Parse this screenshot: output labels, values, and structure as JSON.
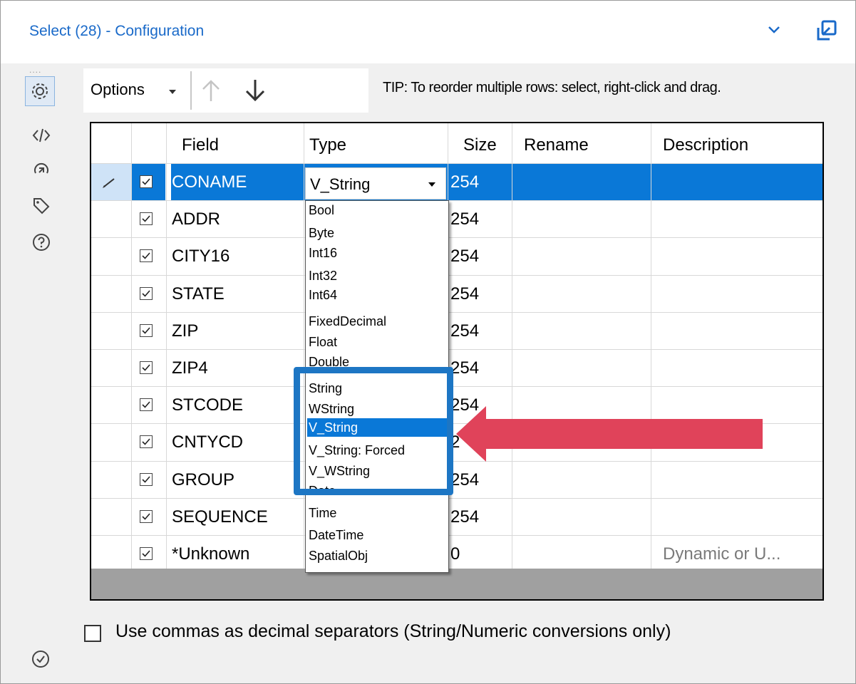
{
  "window": {
    "title": "Select (28) - Configuration"
  },
  "sidebar": {
    "grip": "....",
    "icons": [
      "settings-icon",
      "code-icon",
      "annotation-icon",
      "tag-icon",
      "help-icon",
      "check-circle-icon"
    ]
  },
  "toolbar": {
    "options_label": "Options",
    "tip": "TIP: To reorder multiple rows: select, right-click and drag."
  },
  "grid": {
    "headers": {
      "field": "Field",
      "type": "Type",
      "size": "Size",
      "rename": "Rename",
      "description": "Description"
    },
    "rows": [
      {
        "checked": true,
        "field": "CONAME",
        "size": "254",
        "selected": true
      },
      {
        "checked": true,
        "field": "ADDR",
        "size": "254"
      },
      {
        "checked": true,
        "field": "CITY16",
        "size": "254"
      },
      {
        "checked": true,
        "field": "STATE",
        "size": "254"
      },
      {
        "checked": true,
        "field": "ZIP",
        "size": "254"
      },
      {
        "checked": true,
        "field": "ZIP4",
        "size": "254"
      },
      {
        "checked": true,
        "field": "STCODE",
        "size": "254"
      },
      {
        "checked": true,
        "field": "CNTYCD",
        "size": "2"
      },
      {
        "checked": true,
        "field": "GROUP",
        "size": "254"
      },
      {
        "checked": true,
        "field": "SEQUENCE",
        "size": "254"
      },
      {
        "checked": true,
        "field": "*Unknown",
        "size": "0",
        "description": "Dynamic or U..."
      }
    ],
    "type_combo_value": "V_String"
  },
  "type_dropdown": {
    "options": [
      "Bool",
      "Byte",
      "Int16",
      "Int32",
      "Int64",
      "FixedDecimal",
      "Float",
      "Double",
      "String",
      "WString",
      "V_String",
      "V_String: Forced",
      "V_WString",
      "Date",
      "Time",
      "DateTime",
      "SpatialObj"
    ],
    "highlighted": "V_String"
  },
  "annotation": {
    "box_color": "#1d76c4",
    "arrow_color": "#e0435a"
  },
  "footer": {
    "checkbox_label": "Use commas as decimal separators (String/Numeric conversions only)",
    "checked": false
  },
  "colors": {
    "accent": "#0a78d7",
    "title": "#1a6ac9"
  }
}
